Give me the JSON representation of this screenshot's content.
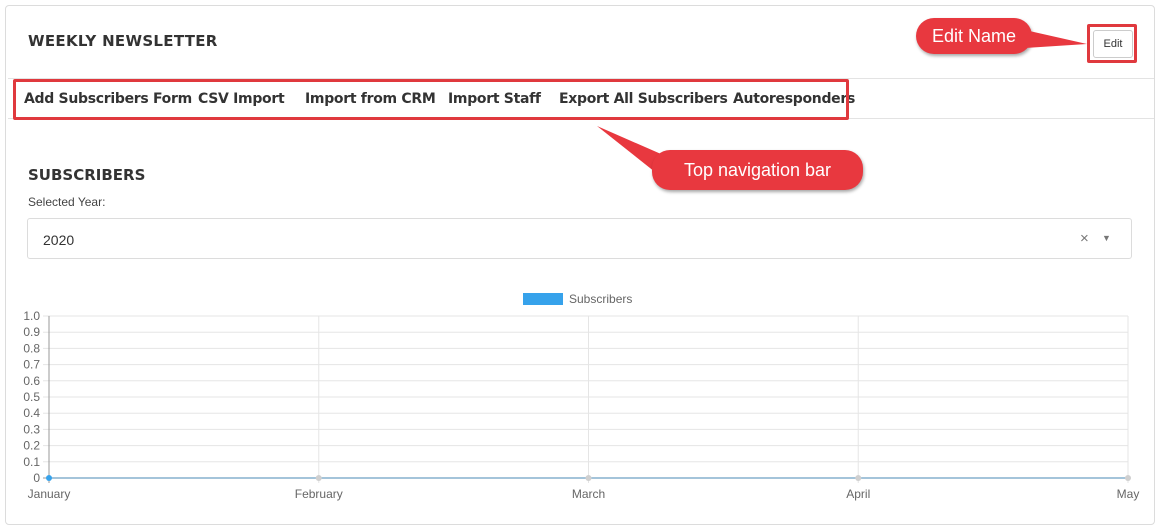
{
  "panel": {
    "title": "WEEKLY NEWSLETTER",
    "edit_label": "Edit"
  },
  "callouts": {
    "edit": "Edit Name",
    "nav": "Top navigation bar"
  },
  "nav": {
    "items": [
      {
        "label": "Add Subscribers Form"
      },
      {
        "label": "CSV Import"
      },
      {
        "label": "Import from CRM"
      },
      {
        "label": "Import Staff"
      },
      {
        "label": "Export All Subscribers"
      },
      {
        "label": "Autoresponders"
      }
    ]
  },
  "subscribers": {
    "title": "SUBSCRIBERS",
    "year_label": "Selected Year:",
    "year_value": "2020",
    "clear_symbol": "×",
    "caret_symbol": "▼"
  },
  "colors": {
    "accent": "#36a2eb",
    "callout": "#e8383f",
    "highlight": "#e0393e"
  },
  "chart_data": {
    "type": "line",
    "categories": [
      "January",
      "February",
      "March",
      "April",
      "May"
    ],
    "series": [
      {
        "name": "Subscribers",
        "values": [
          0,
          0,
          0,
          0,
          0
        ],
        "color": "#36a2eb"
      }
    ],
    "ylim": [
      0,
      1
    ],
    "yticks": [
      "1.0",
      "0.9",
      "0.8",
      "0.7",
      "0.6",
      "0.5",
      "0.4",
      "0.3",
      "0.2",
      "0.1",
      "0"
    ],
    "legend": "top",
    "grid": true,
    "xlabel": "",
    "ylabel": ""
  }
}
